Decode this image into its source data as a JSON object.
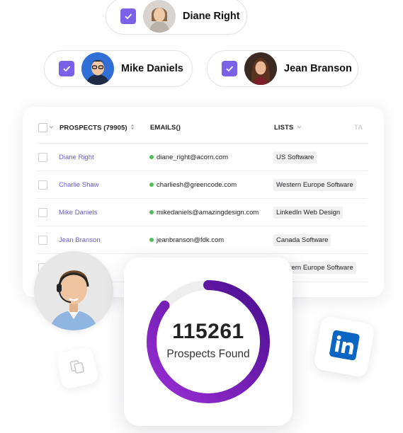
{
  "chips": [
    {
      "name": "Diane Right"
    },
    {
      "name": "Mike Daniels"
    },
    {
      "name": "Jean Branson"
    }
  ],
  "table": {
    "headers": {
      "prospects": "PROSPECTS (79905)",
      "emails": "EMAILS()",
      "lists": "LISTS",
      "tags": "TA"
    },
    "rows": [
      {
        "name": "Diane Right",
        "email": "diane_right@acorn.com",
        "list": "US Software"
      },
      {
        "name": "Charlie Shaw",
        "email": "charliesh@greencode.com",
        "list": "Western Europe Software"
      },
      {
        "name": "Mike Daniels",
        "email": "mikedaniels@amazingdesign.com",
        "list": "LinkedIn Web Design"
      },
      {
        "name": "Jean Branson",
        "email": "jeanbranson@fdk.com",
        "list": "Canada Software"
      },
      {
        "name": "",
        "email": "",
        "list": "Western Europe Software"
      }
    ]
  },
  "summary": {
    "count": "115261",
    "label": "Prospects Found",
    "progress": 0.86
  },
  "colors": {
    "accent": "#7b61e8",
    "ring_start": "#9b2fd6",
    "ring_end": "#4a0d8f",
    "email_status": "#52c05a",
    "linkedin": "#0a66c2"
  },
  "icons": [
    "check-icon",
    "sort-icon",
    "chevron-down-icon",
    "headset-icon",
    "copy-icon",
    "linkedin-icon"
  ]
}
